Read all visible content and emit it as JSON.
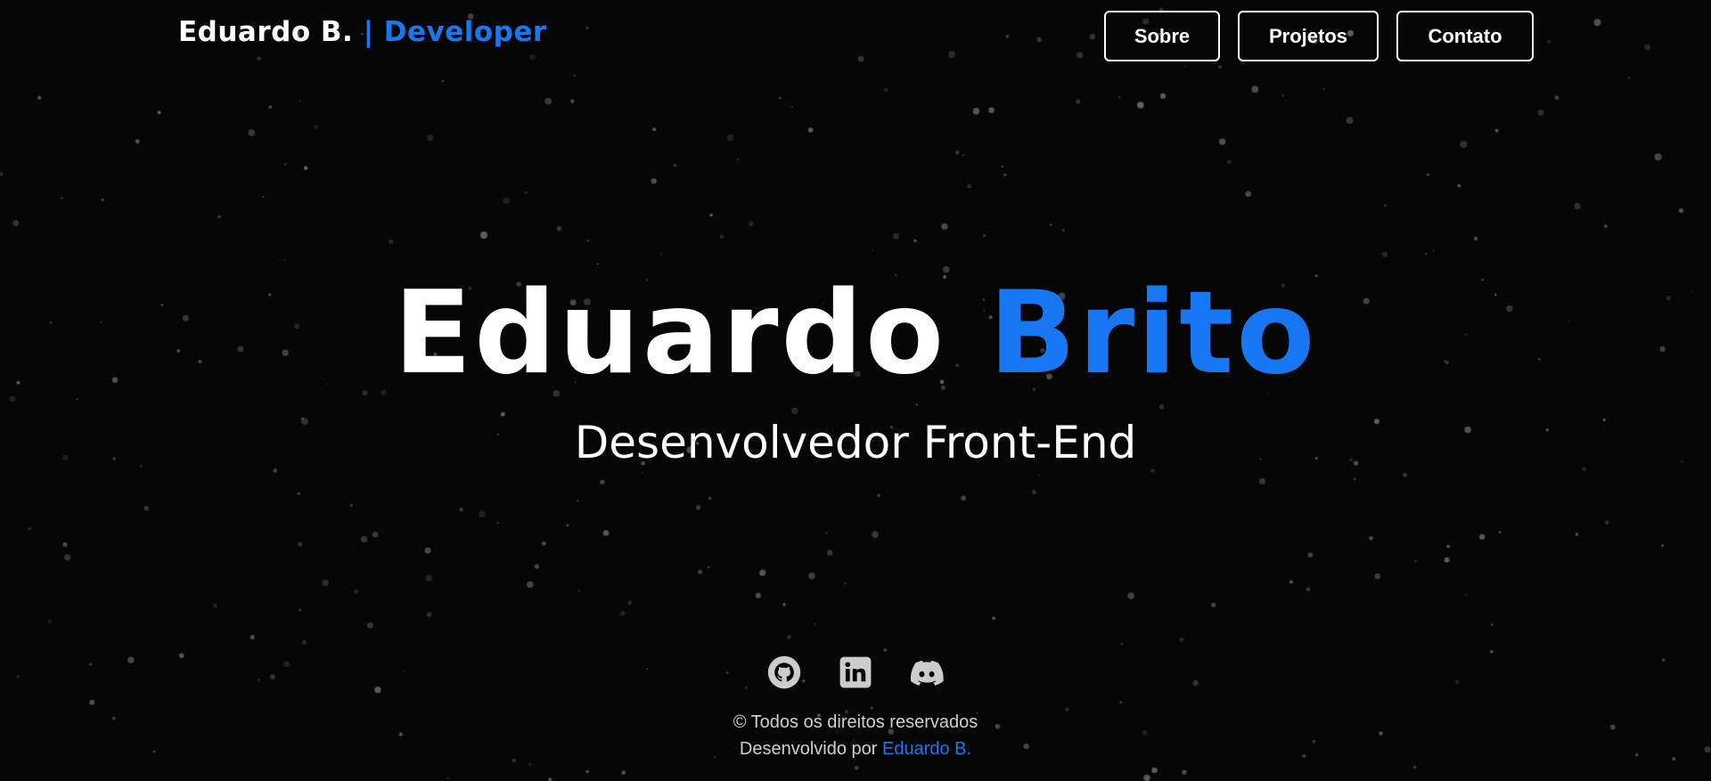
{
  "header": {
    "brand_name": "Eduardo B.",
    "brand_separator_role": "| Developer",
    "nav": {
      "sobre": "Sobre",
      "projetos": "Projetos",
      "contato": "Contato"
    }
  },
  "hero": {
    "first_name": "Eduardo",
    "last_name": "Brito",
    "subtitle": "Desenvolvedor Front-End"
  },
  "socials": {
    "github": "github-icon",
    "linkedin": "linkedin-icon",
    "discord": "discord-icon"
  },
  "footer": {
    "copyright": "© Todos os direitos reservados",
    "developed_by": "Desenvolvido por",
    "author": "Eduardo B."
  },
  "colors": {
    "background": "#060606",
    "accent": "#1877f2",
    "text": "#ffffff",
    "muted_text": "#cfcfcf",
    "icon": "#cccccc"
  }
}
